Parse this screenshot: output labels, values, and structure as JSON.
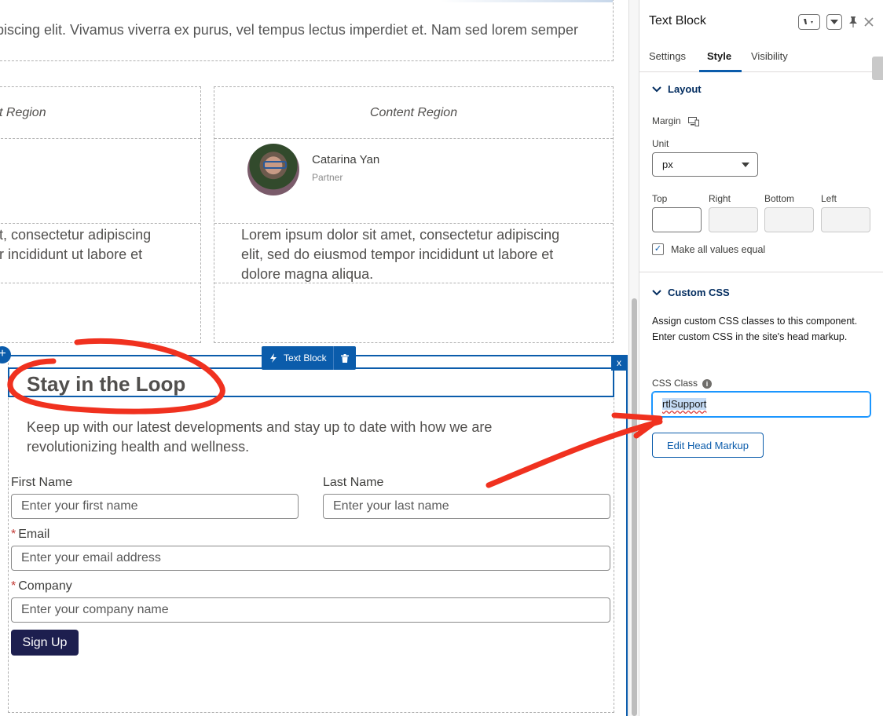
{
  "canvas": {
    "top_paragraph": "ipiscing elit. Vivamus viverra ex purus, vel tempus lectus imperdiet et. Nam sed lorem semper",
    "left_region_title": "t Region",
    "right_region_title": "Content Region",
    "profile": {
      "name": "Catarina Yan",
      "role": "Partner"
    },
    "left_lorem": [
      "t, consectetur adipiscing",
      "r incididunt ut labore et"
    ],
    "right_lorem": [
      "Lorem ipsum dolor sit amet, consectetur adipiscing",
      "elit, sed do eiusmod tempor incididunt ut labore et",
      "dolore magna aliqua."
    ],
    "component_tag": "Text Block",
    "close_label": "x",
    "add_label": "+",
    "section": {
      "heading": "Stay in the Loop",
      "intro": "Keep up with our latest developments and stay up to date with how we are revolutionizing health and wellness."
    },
    "form": {
      "first_name_label": "First Name",
      "first_name_placeholder": "Enter your first name",
      "last_name_label": "Last Name",
      "last_name_placeholder": "Enter your last name",
      "email_label": "Email",
      "email_placeholder": "Enter your email address",
      "company_label": "Company",
      "company_placeholder": "Enter your company name",
      "required_marker": "*",
      "submit_label": "Sign Up"
    },
    "annotation_color": "#f0311f"
  },
  "panel": {
    "title": "Text Block",
    "tabs": [
      "Settings",
      "Style",
      "Visibility"
    ],
    "active_tab": "Style",
    "layout": {
      "header": "Layout",
      "margin_label": "Margin",
      "unit_label": "Unit",
      "unit_value": "px",
      "top_label": "Top",
      "right_label": "Right",
      "bottom_label": "Bottom",
      "left_label": "Left",
      "equal_label": "Make all values equal",
      "equal_checked": true
    },
    "custom_css": {
      "header": "Custom CSS",
      "description": "Assign custom CSS classes to this component. Enter custom CSS in the site's head markup.",
      "class_label": "CSS Class",
      "class_value": "rtlSupport",
      "edit_button": "Edit Head Markup"
    }
  },
  "colors": {
    "accent": "#0b5cab",
    "header": "#032d60",
    "button_dark": "#1d1f4f"
  }
}
